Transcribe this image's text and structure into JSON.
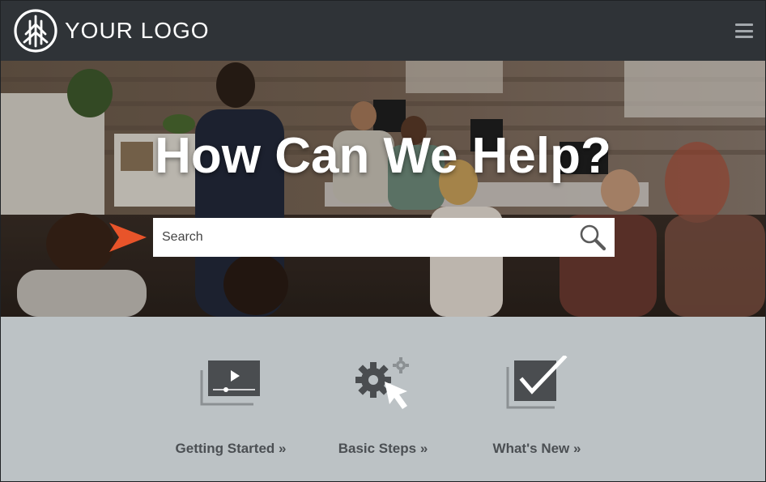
{
  "header": {
    "logo_text": "YOUR LOGO",
    "logo_icon": "pine-tree-icon",
    "menu_icon": "hamburger-menu-icon"
  },
  "hero": {
    "title": "How Can We Help?",
    "search": {
      "placeholder": "Search",
      "value": "",
      "icon": "magnifier-icon",
      "pointer_icon": "orange-arrow-icon"
    }
  },
  "tiles": [
    {
      "label": "Getting Started »",
      "icon": "video-play-icon"
    },
    {
      "label": "Basic Steps »",
      "icon": "gears-cursor-icon"
    },
    {
      "label": "What's New »",
      "icon": "checkbox-check-icon"
    }
  ],
  "colors": {
    "header_bg": "#2f3337",
    "tiles_bg": "#bcc2c5",
    "tile_icon": "#4a4d50",
    "arrow_accent": "#e8542a",
    "white": "#ffffff"
  }
}
